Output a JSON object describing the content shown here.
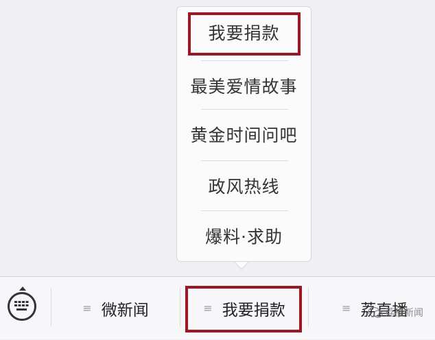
{
  "popup_menu": {
    "items": [
      {
        "label": "我要捐款"
      },
      {
        "label": "最美爱情故事"
      },
      {
        "label": "黄金时间问吧"
      },
      {
        "label": "政风热线"
      },
      {
        "label": "爆料·求助"
      }
    ]
  },
  "tab_bar": {
    "tabs": [
      {
        "label": "微新闻"
      },
      {
        "label": "我要捐款"
      },
      {
        "label": "荔直播"
      }
    ]
  },
  "watermark": {
    "text": "荔枝新闻"
  },
  "colors": {
    "highlight_border": "#a31420",
    "background": "#efeff4",
    "popup_bg": "#fbfbfb",
    "text": "#333333"
  }
}
